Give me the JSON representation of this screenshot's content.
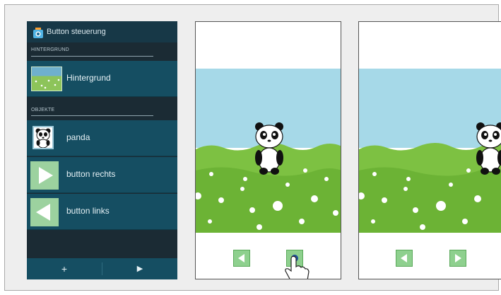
{
  "app": {
    "title": "Button steuerung",
    "icon": "camera-app-icon"
  },
  "sections": {
    "background_label": "HINTERGRUND",
    "objects_label": "OBJEKTE"
  },
  "items": [
    {
      "label": "Hintergrund",
      "icon": "meadow-thumbnail"
    },
    {
      "label": "panda",
      "icon": "panda-thumbnail"
    },
    {
      "label": "button rechts",
      "icon": "arrow-right-thumbnail"
    },
    {
      "label": "button links",
      "icon": "arrow-left-thumbnail"
    }
  ],
  "bottom_bar": {
    "add": "+",
    "play": "▶"
  },
  "colors": {
    "sky": "#a6d9e8",
    "grass": "#7dc142",
    "panel": "#154e62",
    "button": "#8ed08e"
  }
}
